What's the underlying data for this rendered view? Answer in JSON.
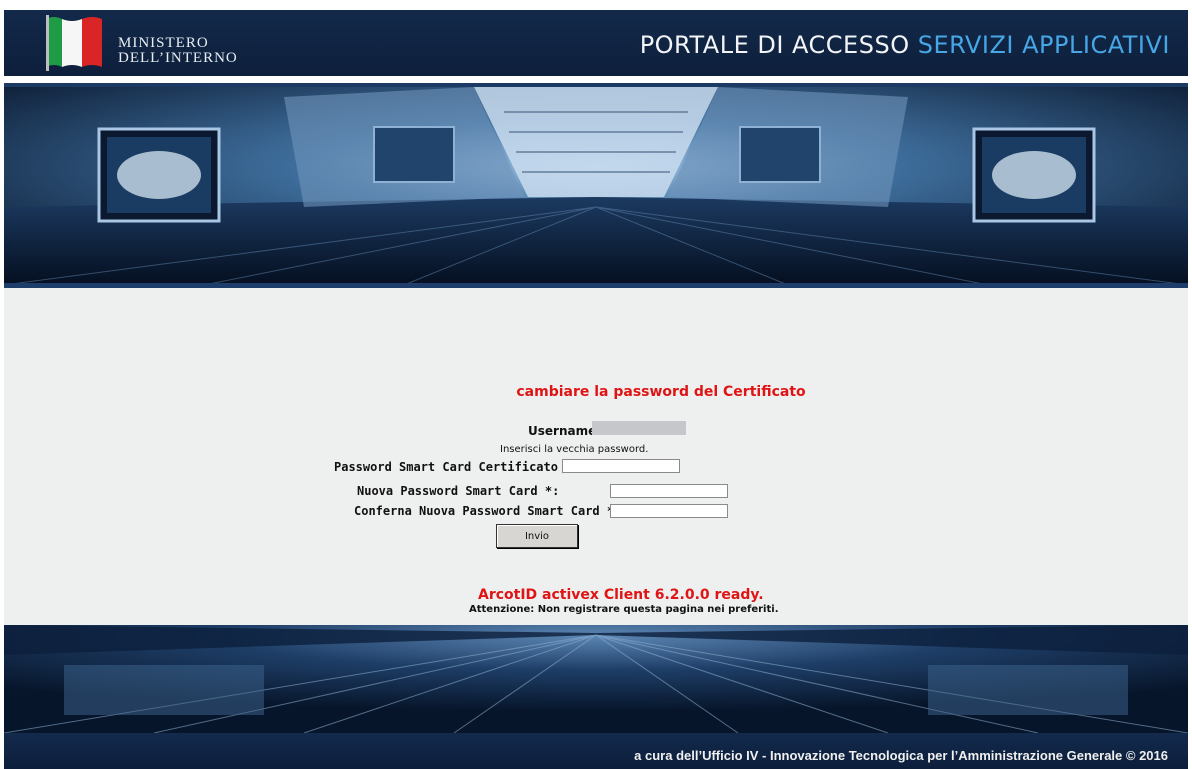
{
  "header": {
    "ministry_line1": "MINISTERO",
    "ministry_line2": "DELL’INTERNO",
    "portal_title_main": "PORTALE DI ACCESSO",
    "portal_title_highlight": "SERVIZI APPLICATIVI",
    "flag_colors": {
      "green": "#1f9b46",
      "white": "#f6f6f6",
      "red": "#d92525"
    }
  },
  "form": {
    "title": "cambiare la password del Certificato",
    "username_label": "Username:",
    "username_value": "",
    "hint": "Inserisci la vecchia password.",
    "old_password_label": "Password Smart Card Certificato :",
    "new_password_label": "Nuova Password Smart Card *:",
    "confirm_password_label": "Conferna Nuova Password Smart Card *:",
    "submit_label": "Invio"
  },
  "status": {
    "ready_text": "ArcotID activex Client 6.2.0.0 ready.",
    "warning_text": "Attenzione: Non registrare questa pagina nei preferiti."
  },
  "footer": {
    "credit_text": "a cura dell’Ufficio IV - Innovazione Tecnologica per l’Amministrazione Generale  © 2016"
  },
  "colors": {
    "header_bg": "#13294a",
    "title_highlight": "#46a6e6",
    "accent_red": "#e01414",
    "content_bg": "#eeefef"
  }
}
